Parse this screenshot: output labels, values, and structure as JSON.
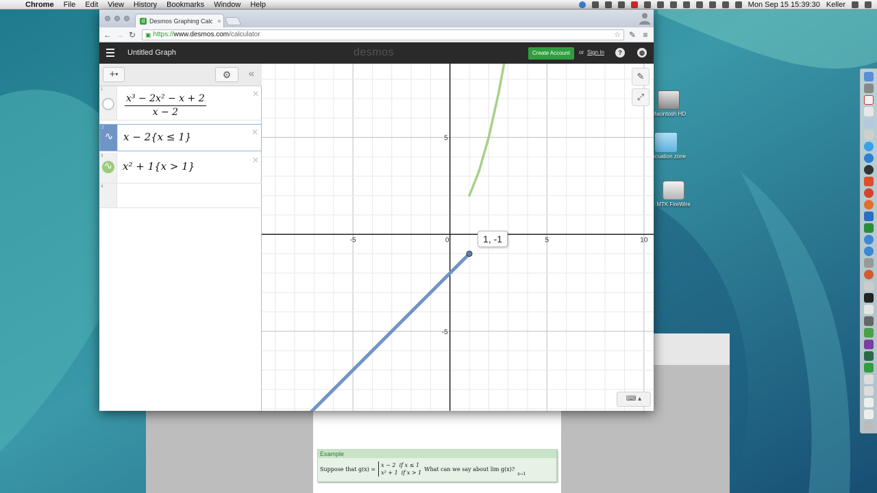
{
  "menubar": {
    "app": "Chrome",
    "items": [
      "File",
      "Edit",
      "View",
      "History",
      "Bookmarks",
      "Window",
      "Help"
    ],
    "clock": "Mon Sep 15  15:39:30",
    "user": "Keller"
  },
  "desktop": {
    "icons": [
      "Macintosh HD",
      "evacuation zone",
      "MTK FireWire"
    ]
  },
  "browser": {
    "tab_title": "Desmos Graphing Calculat",
    "url_scheme": "https://",
    "url_host": "www.desmos.com",
    "url_path": "/calculator"
  },
  "desmos": {
    "graph_title": "Untitled Graph",
    "logo": "desmos",
    "create_account": "Create Account",
    "or": "or",
    "sign_in": "Sign In",
    "expressions": [
      {
        "num": "1",
        "numerator": "x³ − 2x² − x + 2",
        "denominator": "x − 2"
      },
      {
        "num": "2",
        "latex": "x − 2{x ≤ 1}"
      },
      {
        "num": "3",
        "latex": "x² + 1{x > 1}"
      },
      {
        "num": "4"
      }
    ],
    "tooltip": "1, -1",
    "colors": {
      "blue": "#6f95c6",
      "green": "#9ccc7a",
      "accent": "#2f9e3f"
    }
  },
  "chart_data": {
    "type": "line",
    "xlim": [
      -9.7,
      10.5
    ],
    "ylim": [
      -9.1,
      8.8
    ],
    "x_ticks": [
      "-5",
      "0",
      "5",
      "10"
    ],
    "y_ticks": [
      "5",
      "-5"
    ],
    "grid": true,
    "series": [
      {
        "name": "x − 2{x ≤ 1}",
        "color": "#6f95c6",
        "x": [
          -7.2,
          1
        ],
        "y": [
          -9.2,
          -1
        ]
      },
      {
        "name": "x² + 1{x > 1}",
        "color": "#9ccc7a",
        "x": [
          1,
          1.5,
          2,
          2.5,
          2.8
        ],
        "y": [
          2,
          3.25,
          5,
          7.25,
          8.84
        ]
      }
    ],
    "point": {
      "x": 1,
      "y": -1
    }
  },
  "document": {
    "example_heading": "Example",
    "example_prefix": "Suppose that g(x) =",
    "case1_expr": "x − 2",
    "case1_cond": "if x ≤ 1",
    "case2_expr": "x² + 1",
    "case2_cond": "if x > 1",
    "example_question": "What can we say about lim g(x)?",
    "limit_sub": "x→1"
  }
}
